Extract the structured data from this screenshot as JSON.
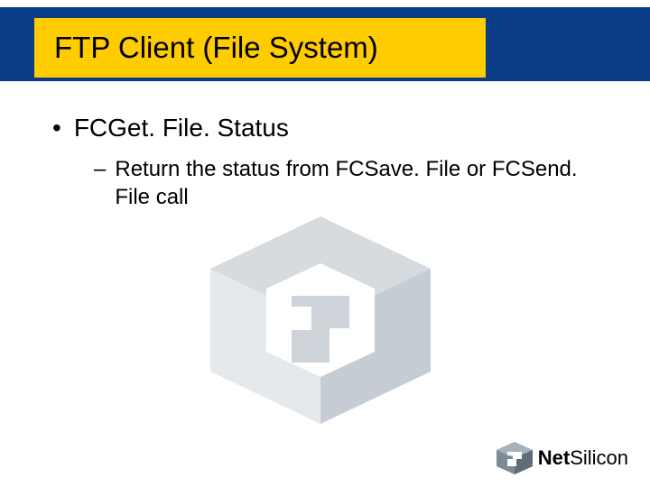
{
  "title": "FTP Client (File System)",
  "bullets": {
    "l1": "FCGet. File. Status",
    "l2": "Return the status from FCSave. File or FCSend. File call"
  },
  "footer": {
    "brand_bold": "Net",
    "brand_rest": "Silicon"
  }
}
